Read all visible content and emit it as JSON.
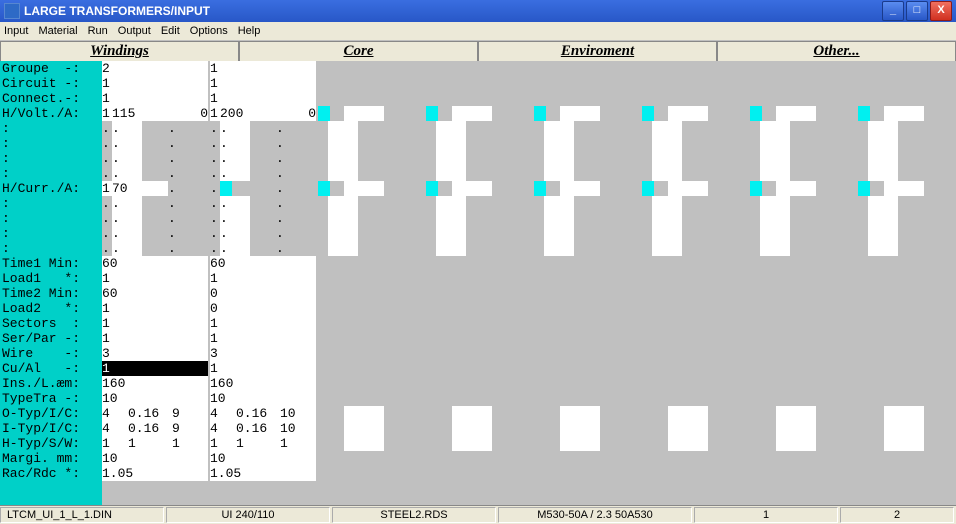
{
  "window": {
    "title": "LARGE TRANSFORMERS/INPUT"
  },
  "menu": {
    "items": [
      "Input",
      "Material",
      "Run",
      "Output",
      "Edit",
      "Options",
      "Help"
    ]
  },
  "tabs": {
    "items": [
      "Windings",
      "Core",
      "Enviroment",
      "Other..."
    ]
  },
  "labels": [
    "Groupe  -:",
    "Circuit -:",
    "Connect.-:",
    "H/Volt./A:",
    ":",
    ":",
    ":",
    ":",
    "H/Curr./A:",
    ":",
    ":",
    ":",
    ":",
    "Time1 Min:",
    "Load1   *:",
    "Time2 Min:",
    "Load2   *:",
    "Sectors  :",
    "Ser/Par -:",
    "Wire    -:",
    "Cu/Al   -:",
    "Ins./L.æm:",
    "TypeTra -:",
    "O-Typ/I/C:",
    "I-Typ/I/C:",
    "H-Typ/S/W:",
    "Margi. mm:",
    "Rac/Rdc *:"
  ],
  "col1": {
    "r0": "2",
    "r1": "1",
    "r2": "1",
    "r3_a": "1",
    "r3_b": "115",
    "r3_c": "0",
    "r4": ".",
    "r4b": ".",
    "r4c": ".",
    "r5": ".",
    "r5b": ".",
    "r5c": ".",
    "r6": ".",
    "r6b": ".",
    "r6c": ".",
    "r7": ".",
    "r7b": ".",
    "r7c": ".",
    "r8_a": "1",
    "r8_b": "70",
    "r8_c": ".",
    "r9": ".",
    "r9b": ".",
    "r9c": ".",
    "r10": ".",
    "r10b": ".",
    "r10c": ".",
    "r11": ".",
    "r11b": ".",
    "r11c": ".",
    "r12": ".",
    "r12b": ".",
    "r12c": ".",
    "r13": "60",
    "r14": "1",
    "r15": "60",
    "r16": "1",
    "r17": "1",
    "r18": "1",
    "r19": "3",
    "r20": "1",
    "r21": "160",
    "r22": "10",
    "r23_a": "4",
    "r23_b": "0.16",
    "r23_c": "9",
    "r24_a": "4",
    "r24_b": "0.16",
    "r24_c": "9",
    "r25_a": "1",
    "r25_b": "1",
    "r25_c": "1",
    "r26": "10",
    "r27": "1.05"
  },
  "col2": {
    "r0": "1",
    "r1": "1",
    "r2": "1",
    "r3_a": "1",
    "r3_b": "200",
    "r3_c": "0",
    "r4": ".",
    "r4b": ".",
    "r4c": ".",
    "r5": ".",
    "r5b": ".",
    "r5c": ".",
    "r6": ".",
    "r6b": ".",
    "r6c": ".",
    "r7": ".",
    "r7b": ".",
    "r7c": ".",
    "r8_a": ".",
    "r8_c": ".",
    "r9": ".",
    "r9b": ".",
    "r9c": ".",
    "r10": ".",
    "r10b": ".",
    "r10c": ".",
    "r11": ".",
    "r11b": ".",
    "r11c": ".",
    "r12": ".",
    "r12b": ".",
    "r12c": ".",
    "r13": "60",
    "r14": "1",
    "r15": "0",
    "r16": "0",
    "r17": "1",
    "r18": "1",
    "r19": "3",
    "r20": "1",
    "r21": "160",
    "r22": "10",
    "r23_a": "4",
    "r23_b": "0.16",
    "r23_c": "10",
    "r24_a": "4",
    "r24_b": "0.16",
    "r24_c": "10",
    "r25_a": "1",
    "r25_b": "1",
    "r25_c": "1",
    "r26": "10",
    "r27": "1.05"
  },
  "status": {
    "panes": [
      "LTCM_UI_1_L_1.DIN",
      "UI 240/110",
      "STEEL2.RDS",
      "M530-50A / 2.3 50A530",
      "1",
      "2"
    ]
  }
}
